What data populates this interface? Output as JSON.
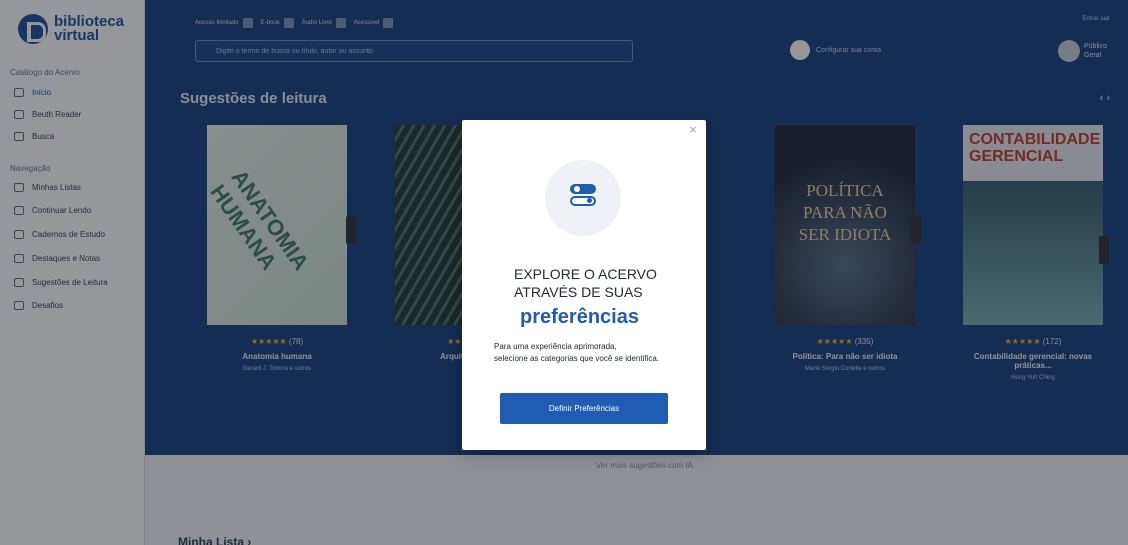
{
  "brand": {
    "name_line1": "biblioteca",
    "name_line2": "virtual"
  },
  "sidebar": {
    "section1": "Catálogo do Acervo",
    "items_main": [
      {
        "label": "Início",
        "icon": "home-icon"
      },
      {
        "label": "Beuth Reader",
        "icon": "book-icon"
      },
      {
        "label": "Busca",
        "icon": "search-icon"
      }
    ],
    "section2": "Navegação",
    "items_nav": [
      {
        "label": "Minhas Listas",
        "icon": "list-icon"
      },
      {
        "label": "Continuar Lendo",
        "icon": "book-open-icon"
      },
      {
        "label": "Cadernos de Estudo",
        "icon": "notebook-icon"
      },
      {
        "label": "Destaques e Notas",
        "icon": "highlight-icon"
      },
      {
        "label": "Sugestões de Leitura",
        "icon": "star-icon"
      },
      {
        "label": "Desafios",
        "icon": "flag-icon"
      }
    ]
  },
  "header": {
    "filters": [
      "Acesso Ilimitado",
      "E-book",
      "Áudio Livro",
      "Acessível"
    ],
    "search_placeholder": "Digite o termo de busca ou título, autor ou assunto",
    "config_label": "Configurar sua conta",
    "user_top": "Entrar sair",
    "user_name": "Público Geral"
  },
  "suggestions": {
    "title": "Sugestões de leitura",
    "arrows": "‹  ›",
    "books": [
      {
        "cover_text": "ANATOMIA HUMANA",
        "rating_count": "(78)",
        "title": "Anatomia humana",
        "author": "Gerard J. Tortora e outros"
      },
      {
        "cover_text": "",
        "rating_count": "",
        "title": "Arquitetura e",
        "author": ""
      },
      {
        "cover_text": "POLÍTICA PARA NÃO SER IDIOTA",
        "rating_count": "(335)",
        "title": "Política: Para não ser idiota",
        "author": "Mario Sergio Cortella e outros"
      },
      {
        "cover_text": "CONTABILIDADE GERENCIAL",
        "rating_count": "(172)",
        "title": "Contabilidade gerencial: novas práticas...",
        "author": "Hong Yuh Ching"
      }
    ],
    "see_more": "Ver mais sugestões com IA"
  },
  "my_list": "Minha Lista  ›",
  "modal": {
    "heading_line1": "EXPLORE O ACERVO",
    "heading_line2": "ATRAVÉS DE SUAS",
    "highlight": "preferências",
    "body_line1": "Para uma experiência aprimorada,",
    "body_line2": "selecione as categorias que você se identifica.",
    "button_label": "Definir Preferências",
    "close": "×"
  },
  "colors": {
    "primary": "#1f5cb2",
    "header_bg": "#153f7d",
    "rating": "#f2b33d"
  }
}
